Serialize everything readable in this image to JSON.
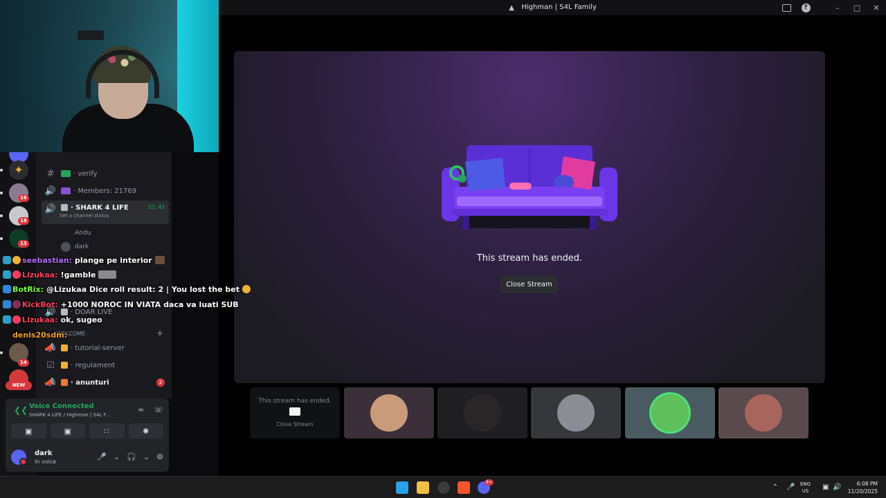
{
  "window": {
    "title": "Highman | S4L Family",
    "help_label": "?"
  },
  "channels": [
    {
      "name": "verify",
      "emoji_color": "#23a55a",
      "type": "text"
    },
    {
      "name": "Members: 21769",
      "emoji_color": "#8a4fd1",
      "type": "voice"
    },
    {
      "name": "SHARK 4 LIFE",
      "type": "voice",
      "active": true,
      "time": "55:41",
      "status": "Set a channel status"
    },
    {
      "name": "DOAR LIVE",
      "type": "voice"
    },
    {
      "name": "tutorial-server",
      "emoji_color": "#f0b232",
      "type": "announce"
    },
    {
      "name": "regulament",
      "emoji_color": "#f0b232",
      "type": "rules"
    },
    {
      "name": "anunturi",
      "emoji_color": "#f57731",
      "type": "announce",
      "badge": "2"
    }
  ],
  "voice_users": [
    "Andu",
    "dark"
  ],
  "category": "WELCOME",
  "rail_badges": [
    "16",
    "18",
    "13",
    "14"
  ],
  "rail_new_label": "NEW",
  "chat": [
    {
      "user": "seebastian:",
      "msg": "plange pe interior",
      "color": "#b36bff",
      "badge": "#2aa0c8"
    },
    {
      "user": "Lizukaa:",
      "msg": "!gamble",
      "color": "#ff3b5c",
      "badge": "#2aa0c8"
    },
    {
      "user": "BotRix:",
      "msg": "@Lizukaa Dice roll result: 2 | You lost the bet",
      "color": "#7dff3b",
      "badge": "#2a88d8"
    },
    {
      "user": "KickBot:",
      "msg": "+1000 NOROC IN VIATA daca va luati SUB",
      "color": "#ff3b5c",
      "badge": "#2a88d8"
    },
    {
      "user": "Lizukaa:",
      "msg": "ok, sugeo",
      "color": "#ff3b5c",
      "badge": "#2aa0c8"
    },
    {
      "user": "denis20sdm:",
      "msg": "",
      "color": "#f0a020",
      "badge": "#2aa0c8"
    }
  ],
  "voice_panel": {
    "title": "Voice Connected",
    "subtitle": "SHARK 4 LIFE / Highman | S4L F...",
    "user_name": "dark",
    "user_status": "In voice"
  },
  "stream": {
    "ended_text": "This stream has ended.",
    "close_label": "Close Stream"
  },
  "tiles": [
    {
      "type": "ended",
      "text": "This stream has ended.",
      "button": "Close Stream"
    },
    {
      "type": "avatar",
      "bg": "#3b2f3a",
      "avatar": "#c99b7a"
    },
    {
      "type": "avatar",
      "bg": "#1f1f22",
      "avatar": "#2a2526"
    },
    {
      "type": "avatar",
      "bg": "#36373b",
      "avatar": "#8a8d93"
    },
    {
      "type": "avatar",
      "bg": "#4a5a61",
      "avatar": "#5fbf5a"
    },
    {
      "type": "avatar",
      "bg": "#5a4a4e",
      "avatar": "#a8655c"
    }
  ],
  "taskbar": {
    "lang_top": "ENG",
    "lang_bottom": "US",
    "time": "6:08 PM",
    "date": "11/20/2025",
    "discord_badge": "9+"
  },
  "colors": {
    "voice_green": "#23a55a",
    "badge_red": "#da373c",
    "couch_purple": "#7b3ff2"
  }
}
